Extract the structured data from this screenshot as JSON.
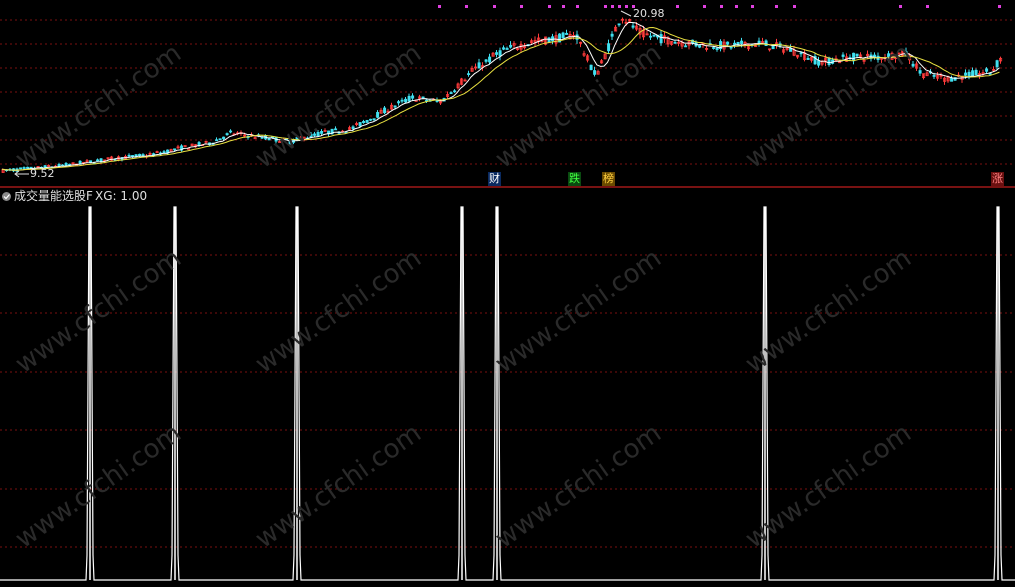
{
  "colors": {
    "background": "#000000",
    "grid": "#7a1010",
    "separator": "#a01818",
    "up_candle": "#ff3b3b",
    "down_candle": "#40e0f0",
    "ma_short": "#ffffff",
    "ma_long": "#e8e040",
    "xg_line": "#ffffff",
    "marker_dot": "#e040e0",
    "tag_cai_bg": "#0a2a60",
    "tag_cai_fg": "#ffffff",
    "tag_die_bg": "#0a4a10",
    "tag_die_fg": "#40ff40",
    "tag_bang_bg": "#6a4a00",
    "tag_bang_fg": "#ffd040",
    "tag_zhang_bg": "#6a1010",
    "tag_zhang_fg": "#ff8080",
    "indicator_text": "#e0e0e0"
  },
  "watermark": "www.cfchi.com",
  "price_panel": {
    "high_label": "20.98",
    "low_label": "9.52",
    "tags": [
      "财",
      "跌",
      "榜",
      "涨"
    ]
  },
  "indicator_panel": {
    "title": "成交量能选股F",
    "value_label": "XG: 1.00"
  },
  "chart_data": [
    {
      "type": "candlestick",
      "title": "",
      "ylim": [
        9.0,
        21.5
      ],
      "max_price": 20.98,
      "min_price": 9.52,
      "grid": true,
      "trend_points": [
        [
          0,
          9.52
        ],
        [
          30,
          9.7
        ],
        [
          60,
          9.9
        ],
        [
          90,
          10.2
        ],
        [
          120,
          10.5
        ],
        [
          150,
          10.7
        ],
        [
          180,
          11.2
        ],
        [
          210,
          11.6
        ],
        [
          230,
          12.3
        ],
        [
          260,
          12.0
        ],
        [
          290,
          11.7
        ],
        [
          320,
          12.3
        ],
        [
          350,
          12.6
        ],
        [
          380,
          13.8
        ],
        [
          410,
          14.9
        ],
        [
          440,
          14.6
        ],
        [
          470,
          16.8
        ],
        [
          500,
          18.3
        ],
        [
          530,
          19.0
        ],
        [
          560,
          19.3
        ],
        [
          575,
          19.6
        ],
        [
          585,
          17.9
        ],
        [
          595,
          16.5
        ],
        [
          605,
          18.2
        ],
        [
          620,
          20.98
        ],
        [
          640,
          19.6
        ],
        [
          670,
          19.1
        ],
        [
          700,
          18.8
        ],
        [
          730,
          18.7
        ],
        [
          760,
          18.9
        ],
        [
          790,
          18.4
        ],
        [
          820,
          17.5
        ],
        [
          850,
          17.9
        ],
        [
          880,
          17.9
        ],
        [
          905,
          18.2
        ],
        [
          920,
          16.7
        ],
        [
          945,
          16.3
        ],
        [
          970,
          16.6
        ],
        [
          990,
          16.8
        ],
        [
          1000,
          17.8
        ]
      ]
    },
    {
      "type": "line",
      "title": "成交量能选股F",
      "series": [
        {
          "name": "XG",
          "latest": 1.0
        }
      ],
      "ylim": [
        0,
        1
      ],
      "signal_bars": [
        90,
        175,
        297,
        462,
        497,
        765,
        998
      ]
    }
  ]
}
